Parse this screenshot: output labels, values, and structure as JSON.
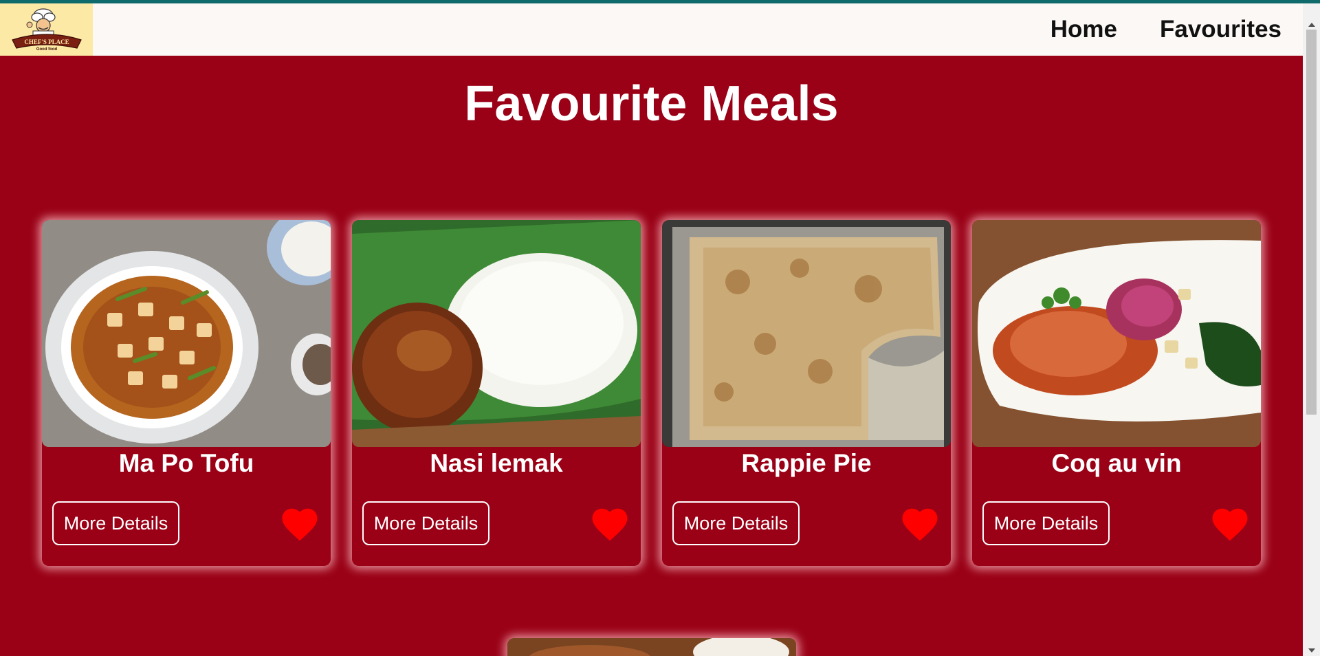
{
  "brand": {
    "logo_text": "CHEF'S PLACE",
    "logo_tagline": "Good food"
  },
  "nav": {
    "home_label": "Home",
    "favourites_label": "Favourites"
  },
  "page": {
    "title": "Favourite Meals"
  },
  "meals": [
    {
      "name": "Ma Po Tofu",
      "button_label": "More Details",
      "favourite": true
    },
    {
      "name": "Nasi lemak",
      "button_label": "More Details",
      "favourite": true
    },
    {
      "name": "Rappie Pie",
      "button_label": "More Details",
      "favourite": true
    },
    {
      "name": "Coq au vin",
      "button_label": "More Details",
      "favourite": true
    }
  ],
  "colors": {
    "background": "#9a0016",
    "navbar": "#fcf8f5",
    "heart": "#ff0000",
    "accent_line": "#0f6b6b"
  },
  "icons": {
    "favourite": "heart-icon"
  }
}
